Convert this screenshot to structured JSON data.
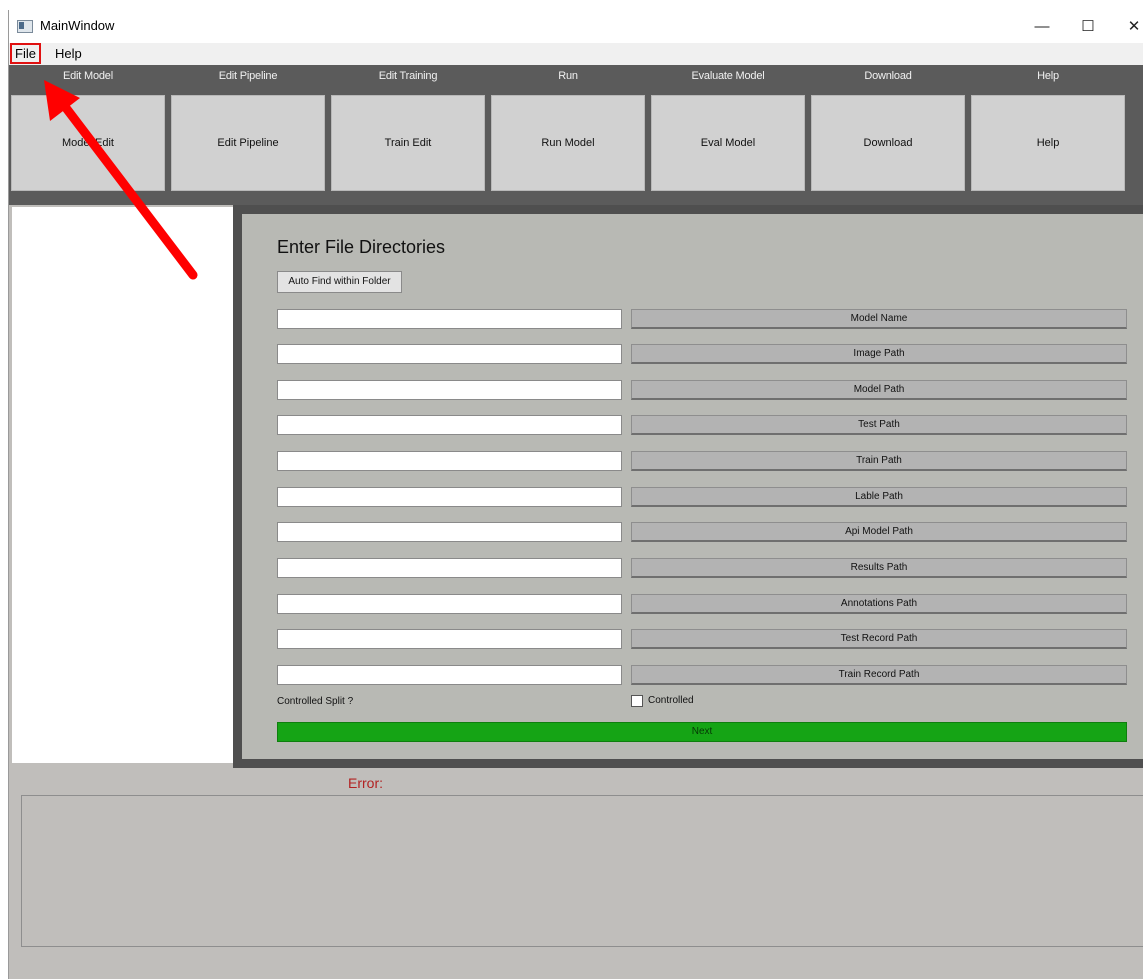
{
  "window": {
    "title": "MainWindow",
    "controls": {
      "minimize": "—",
      "maximize": "☐",
      "close": "✕"
    }
  },
  "menu": {
    "file": "File",
    "help": "Help"
  },
  "toolbar": [
    {
      "label": "Edit Model",
      "button": "Model Edit"
    },
    {
      "label": "Edit Pipeline",
      "button": "Edit Pipeline"
    },
    {
      "label": "Edit Training",
      "button": "Train Edit"
    },
    {
      "label": "Run",
      "button": "Run Model"
    },
    {
      "label": "Evaluate Model",
      "button": "Eval Model"
    },
    {
      "label": "Download",
      "button": "Download"
    },
    {
      "label": "Help",
      "button": "Help"
    }
  ],
  "form": {
    "heading": "Enter File Directories",
    "auto_find": "Auto Find within Folder",
    "paths": [
      {
        "button": "Model Name",
        "value": ""
      },
      {
        "button": "Image Path",
        "value": ""
      },
      {
        "button": "Model Path",
        "value": ""
      },
      {
        "button": "Test Path",
        "value": ""
      },
      {
        "button": "Train Path",
        "value": ""
      },
      {
        "button": "Lable Path",
        "value": ""
      },
      {
        "button": "Api Model Path",
        "value": ""
      },
      {
        "button": "Results Path",
        "value": ""
      },
      {
        "button": "Annotations Path",
        "value": ""
      },
      {
        "button": "Test Record Path",
        "value": ""
      },
      {
        "button": "Train Record Path",
        "value": ""
      }
    ],
    "split_label": "Controlled Split ?",
    "controlled_label": "Controlled",
    "controlled_checked": false,
    "next": "Next"
  },
  "error": {
    "label": "Error:",
    "text": ""
  },
  "colors": {
    "next": "#15a415",
    "error_text": "#b22222",
    "annotation": "#ff0000",
    "toolbar_bg": "#5b5b5b"
  }
}
